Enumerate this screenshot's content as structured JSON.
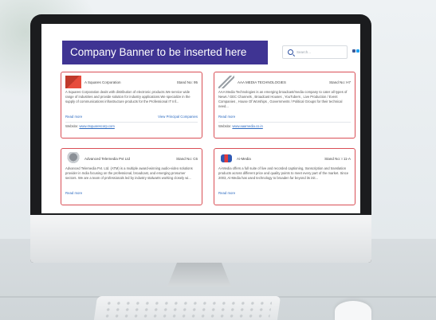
{
  "banner": {
    "text": "Company Banner to be inserted here"
  },
  "search": {
    "placeholder": "Search..."
  },
  "social_colors": [
    "#3b5998",
    "#1da1f2",
    "#0e76a8",
    "#d62d20",
    "#8e44ad"
  ],
  "cards": [
    {
      "company": "A Squares Corporation",
      "stand": "Stand No: 95",
      "logo_icon": "a-squares-logo",
      "description": "A Squares Corporation deals with distribution of electronic products.We service wide range of industries and provide solution for industry applications.We specialize in the supply of communications infrastructure products for the Professional IT Inf...",
      "read_more": "Read more",
      "extra_link": "View Principal Companies",
      "website_label": "Website:",
      "website_url": "www.4squarescorp.com"
    },
    {
      "company": "AAA MEDIA TECHNOLOGIES",
      "stand": "Stand No: H7",
      "logo_icon": "aaa-media-logo",
      "description": "AAA Media Technologies  is an emerging broadcast/media company to cater all types of News / GEC Channels , Broadcast Houses , YouTubers , Live Production / Event Companies , House Of Worships , Governments / Political Groups for their technical need...",
      "read_more": "Read more",
      "extra_link": "",
      "website_label": "Website:",
      "website_url": "www.aaamedia.co.in"
    },
    {
      "company": "Advanced Telemedia Pvt Ltd",
      "stand": "Stand No: C6",
      "logo_icon": "advanced-telemedia-logo",
      "description": "Advanced Telemedia Pvt. Ltd. (ATM) is a multiple award-winning audio-video solutions provider in India focusing on the professional, broadcast, and emerging prosumer sectors. We are a team of professionals led by industry stalwarts working closely wi...",
      "read_more": "Read more"
    },
    {
      "company": "Ai-Media",
      "stand": "Stand No: I 11-A",
      "logo_icon": "ai-media-logo",
      "description": "Ai-Media offers a full suite of live and recorded captioning, transcription and translation products across different price and quality points to meet every part of the market. Since 2003, Ai-Media has used technology to broaden far beyond its init...",
      "read_more": "Read more"
    }
  ]
}
